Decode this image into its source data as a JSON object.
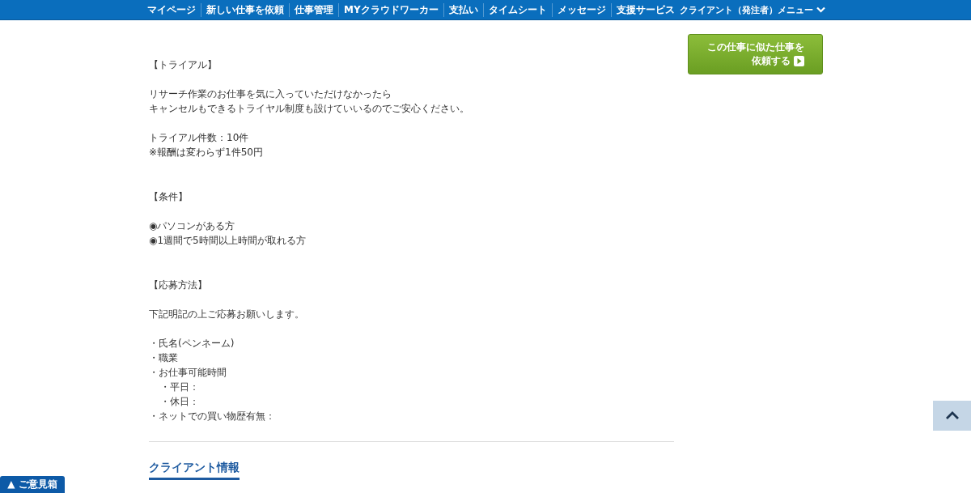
{
  "nav": {
    "items": [
      "マイページ",
      "新しい仕事を依頼",
      "仕事管理",
      "MYクラウドワーカー",
      "支払い",
      "タイムシート",
      "メッセージ",
      "支援サービス"
    ],
    "client_menu": "クライアント（発注者）メニュー"
  },
  "sections": [
    {
      "heading": "【トライアル】",
      "paragraphs": [
        [
          "リサーチ作業のお仕事を気に入っていただけなかったら",
          "キャンセルもできるトライヤル制度も設けていいるのでご安心ください。"
        ],
        [
          "トライアル件数：10件",
          "※報酬は変わらず1件50円"
        ]
      ]
    },
    {
      "heading": "【条件】",
      "paragraphs": [
        [
          "◉パソコンがある方",
          "◉1週間で5時間以上時間が取れる方"
        ]
      ]
    },
    {
      "heading": "【応募方法】",
      "paragraphs": [
        [
          "下記明記の上ご応募お願いします。"
        ]
      ],
      "bullets": [
        {
          "text": "・氏名(ペンネーム)"
        },
        {
          "text": "・職業"
        },
        {
          "text": "・お仕事可能時間",
          "children": [
            {
              "text": "・平日："
            },
            {
              "text": "・休日："
            }
          ]
        },
        {
          "text": "・ネットでの買い物歴有無："
        }
      ]
    }
  ],
  "client_info_heading": "クライアント情報",
  "similar_button": [
    "この仕事に似た仕事を",
    "依頼する"
  ],
  "feedback_tab": "▲ ご意見箱"
}
